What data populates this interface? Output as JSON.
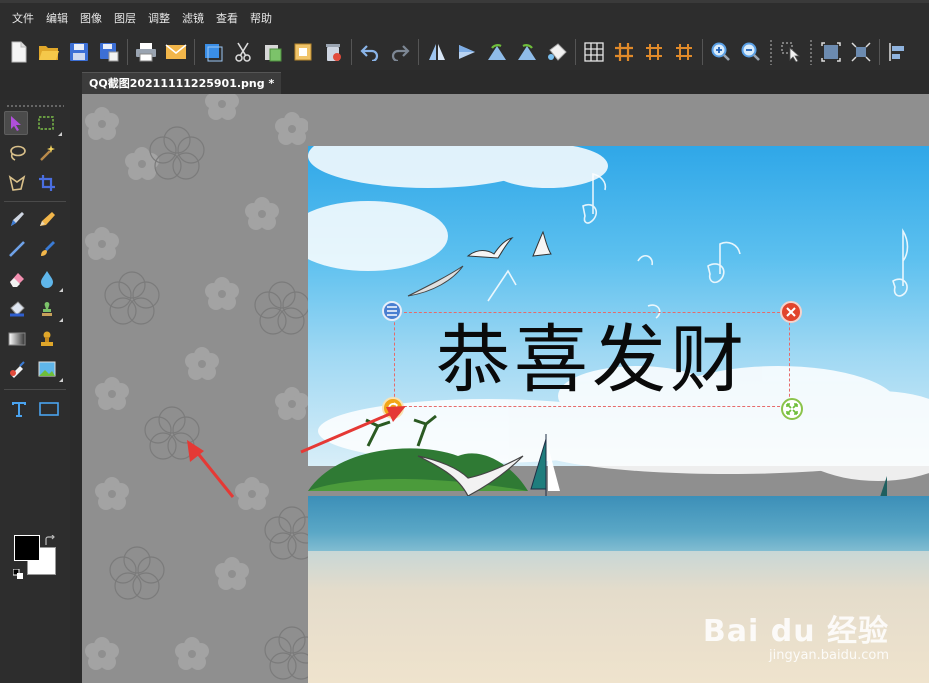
{
  "menu": {
    "items": [
      {
        "label": "文件"
      },
      {
        "label": "编辑"
      },
      {
        "label": "图像"
      },
      {
        "label": "图层"
      },
      {
        "label": "调整"
      },
      {
        "label": "滤镜"
      },
      {
        "label": "查看"
      },
      {
        "label": "帮助"
      }
    ]
  },
  "document": {
    "tab_title": "QQ截图20211111225901.png *"
  },
  "canvas": {
    "text_layer": "恭喜发财"
  },
  "watermark": {
    "brand": "Bai du 经验",
    "url": "jingyan.baidu.com"
  },
  "colors": {
    "foreground": "#000000",
    "background": "#ffffff",
    "annotation_arrow": "#e53935",
    "selection_border": "#e66b6b"
  },
  "icons": {
    "toolbar": [
      "new-file-icon",
      "open-folder-icon",
      "save-icon",
      "save-as-icon",
      "print-icon",
      "email-icon",
      "copy-layer-icon",
      "cut-icon",
      "paste-icon",
      "paste-new-icon",
      "delete-icon",
      "undo-icon",
      "redo-icon",
      "flip-horizontal-icon",
      "flip-vertical-icon",
      "rotate-left-icon",
      "rotate-right-icon",
      "paint-bucket-icon",
      "grid-icon",
      "hash-icon",
      "hash-small-icon",
      "hash-alt-icon",
      "zoom-in-icon",
      "zoom-out-icon",
      "select-cursor-icon",
      "crop-frame-icon",
      "resize-frame-icon",
      "align-left-icon"
    ]
  }
}
